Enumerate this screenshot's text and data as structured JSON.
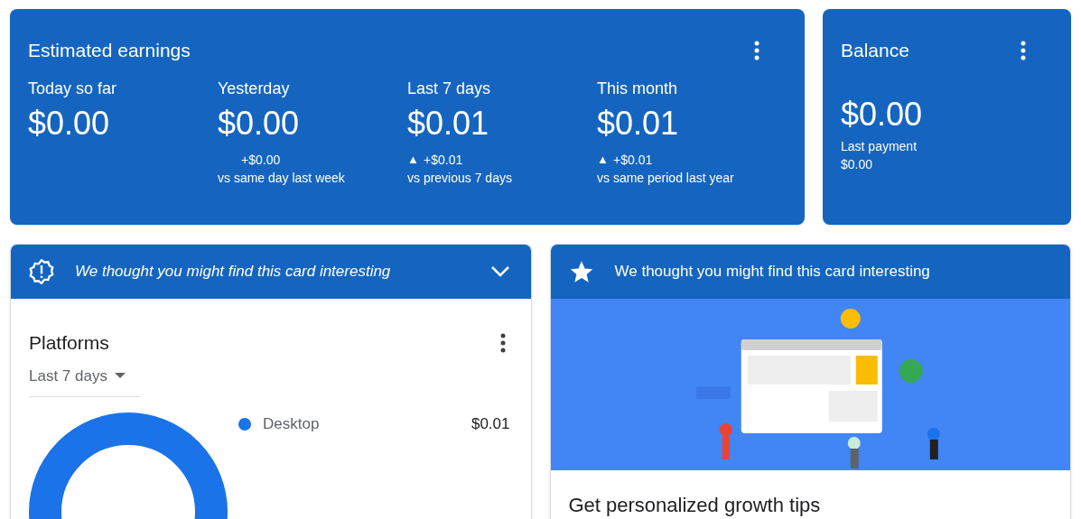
{
  "earnings": {
    "title": "Estimated earnings",
    "stats": [
      {
        "label": "Today so far",
        "value": "$0.00"
      },
      {
        "label": "Yesterday",
        "value": "$0.00",
        "change": "+$0.00",
        "comparison": "vs same day last week"
      },
      {
        "label": "Last 7 days",
        "value": "$0.01",
        "arrow": "▲",
        "change": "+$0.01",
        "comparison": "vs previous 7 days"
      },
      {
        "label": "This month",
        "value": "$0.01",
        "arrow": "▲",
        "change": "+$0.01",
        "comparison": "vs same period last year"
      }
    ]
  },
  "balance": {
    "title": "Balance",
    "value": "$0.00",
    "last_payment_label": "Last payment",
    "last_payment_value": "$0.00"
  },
  "platforms_card": {
    "banner": {
      "text": "We thought you might find this card interesting",
      "expanded": false
    },
    "title": "Platforms",
    "range": "Last 7 days",
    "legend": [
      {
        "name": "Desktop",
        "value": "$0.01",
        "color": "#1a73e8"
      }
    ]
  },
  "tips_card": {
    "banner": {
      "text": "We thought you might find this card interesting"
    },
    "title": "Get personalized growth tips"
  }
}
